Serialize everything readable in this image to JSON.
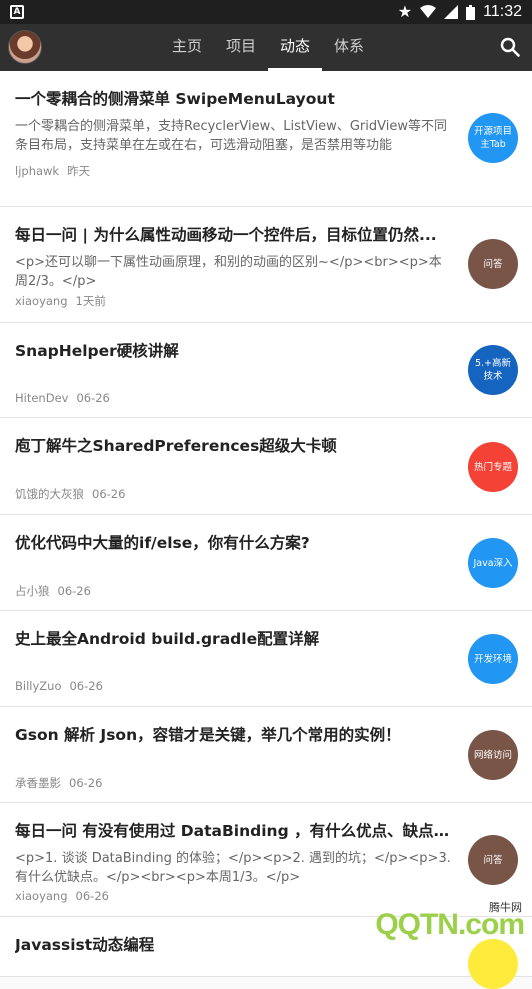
{
  "status_bar": {
    "time": "11:32",
    "app_icon_letter": "A"
  },
  "topbar": {
    "tabs": [
      {
        "label": "主页"
      },
      {
        "label": "项目"
      },
      {
        "label": "动态"
      },
      {
        "label": "体系"
      }
    ],
    "active_tab": "动态"
  },
  "feed": [
    {
      "title": "一个零耦合的侧滑菜单 SwipeMenuLayout",
      "desc": "一个零耦合的侧滑菜单，支持RecyclerView、ListView、GridView等不同条目布局，支持菜单在左或在右，可选滑动阻塞，是否禁用等功能",
      "author": "ljphawk",
      "date": "昨天",
      "tag": "开源项目主Tab",
      "tag_color": "#2196f3"
    },
    {
      "title": "每日一问 | 为什么属性动画移动一个控件后，目标位置仍然...",
      "desc": "<p>还可以聊一下属性动画原理，和别的动画的区别~</p><br><p>本周2/3。</p>",
      "author": "xiaoyang",
      "date": "1天前",
      "tag": "问答",
      "tag_color": "#795548"
    },
    {
      "title": "SnapHelper硬核讲解",
      "desc": "",
      "author": "HitenDev",
      "date": "06-26",
      "tag": "5.+高新技术",
      "tag_color": "#1565c0"
    },
    {
      "title": "庖丁解牛之SharedPreferences超级大卡顿",
      "desc": "",
      "author": "饥饿的大灰狼",
      "date": "06-26",
      "tag": "热门专题",
      "tag_color": "#f44336"
    },
    {
      "title": "优化代码中大量的if/else，你有什么方案?",
      "desc": "",
      "author": "占小狼",
      "date": "06-26",
      "tag": "Java深入",
      "tag_color": "#2196f3"
    },
    {
      "title": "史上最全Android build.gradle配置详解",
      "desc": "",
      "author": "BillyZuo",
      "date": "06-26",
      "tag": "开发环境",
      "tag_color": "#2196f3"
    },
    {
      "title": "Gson 解析 Json，容错才是关键，举几个常用的实例！",
      "desc": "",
      "author": "承香墨影",
      "date": "06-26",
      "tag": "网络访问",
      "tag_color": "#795548"
    },
    {
      "title": "每日一问 有没有使用过 DataBinding ，有什么优点、缺点，...",
      "desc": "<p>1. 谈谈 DataBinding 的体验；</p><p>2. 遇到的坑；</p><p>3. 有什么优缺点。</p><br><p>本周1/3。</p>",
      "author": "xiaoyang",
      "date": "06-26",
      "tag": "问答",
      "tag_color": "#795548"
    },
    {
      "title": "Javassist动态编程",
      "desc": "",
      "author": "",
      "date": "",
      "tag": "",
      "tag_color": "#ffeb3b"
    }
  ],
  "watermark": {
    "text": "QQTN.com",
    "small": "腾牛网"
  }
}
